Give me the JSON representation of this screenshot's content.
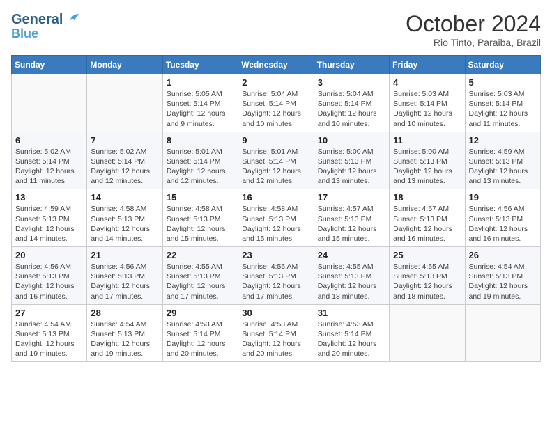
{
  "header": {
    "logo_line1": "General",
    "logo_line2": "Blue",
    "month": "October 2024",
    "location": "Rio Tinto, Paraiba, Brazil"
  },
  "weekdays": [
    "Sunday",
    "Monday",
    "Tuesday",
    "Wednesday",
    "Thursday",
    "Friday",
    "Saturday"
  ],
  "weeks": [
    [
      {
        "day": "",
        "info": ""
      },
      {
        "day": "",
        "info": ""
      },
      {
        "day": "1",
        "info": "Sunrise: 5:05 AM\nSunset: 5:14 PM\nDaylight: 12 hours and 9 minutes."
      },
      {
        "day": "2",
        "info": "Sunrise: 5:04 AM\nSunset: 5:14 PM\nDaylight: 12 hours and 10 minutes."
      },
      {
        "day": "3",
        "info": "Sunrise: 5:04 AM\nSunset: 5:14 PM\nDaylight: 12 hours and 10 minutes."
      },
      {
        "day": "4",
        "info": "Sunrise: 5:03 AM\nSunset: 5:14 PM\nDaylight: 12 hours and 10 minutes."
      },
      {
        "day": "5",
        "info": "Sunrise: 5:03 AM\nSunset: 5:14 PM\nDaylight: 12 hours and 11 minutes."
      }
    ],
    [
      {
        "day": "6",
        "info": "Sunrise: 5:02 AM\nSunset: 5:14 PM\nDaylight: 12 hours and 11 minutes."
      },
      {
        "day": "7",
        "info": "Sunrise: 5:02 AM\nSunset: 5:14 PM\nDaylight: 12 hours and 12 minutes."
      },
      {
        "day": "8",
        "info": "Sunrise: 5:01 AM\nSunset: 5:14 PM\nDaylight: 12 hours and 12 minutes."
      },
      {
        "day": "9",
        "info": "Sunrise: 5:01 AM\nSunset: 5:14 PM\nDaylight: 12 hours and 12 minutes."
      },
      {
        "day": "10",
        "info": "Sunrise: 5:00 AM\nSunset: 5:13 PM\nDaylight: 12 hours and 13 minutes."
      },
      {
        "day": "11",
        "info": "Sunrise: 5:00 AM\nSunset: 5:13 PM\nDaylight: 12 hours and 13 minutes."
      },
      {
        "day": "12",
        "info": "Sunrise: 4:59 AM\nSunset: 5:13 PM\nDaylight: 12 hours and 13 minutes."
      }
    ],
    [
      {
        "day": "13",
        "info": "Sunrise: 4:59 AM\nSunset: 5:13 PM\nDaylight: 12 hours and 14 minutes."
      },
      {
        "day": "14",
        "info": "Sunrise: 4:58 AM\nSunset: 5:13 PM\nDaylight: 12 hours and 14 minutes."
      },
      {
        "day": "15",
        "info": "Sunrise: 4:58 AM\nSunset: 5:13 PM\nDaylight: 12 hours and 15 minutes."
      },
      {
        "day": "16",
        "info": "Sunrise: 4:58 AM\nSunset: 5:13 PM\nDaylight: 12 hours and 15 minutes."
      },
      {
        "day": "17",
        "info": "Sunrise: 4:57 AM\nSunset: 5:13 PM\nDaylight: 12 hours and 15 minutes."
      },
      {
        "day": "18",
        "info": "Sunrise: 4:57 AM\nSunset: 5:13 PM\nDaylight: 12 hours and 16 minutes."
      },
      {
        "day": "19",
        "info": "Sunrise: 4:56 AM\nSunset: 5:13 PM\nDaylight: 12 hours and 16 minutes."
      }
    ],
    [
      {
        "day": "20",
        "info": "Sunrise: 4:56 AM\nSunset: 5:13 PM\nDaylight: 12 hours and 16 minutes."
      },
      {
        "day": "21",
        "info": "Sunrise: 4:56 AM\nSunset: 5:13 PM\nDaylight: 12 hours and 17 minutes."
      },
      {
        "day": "22",
        "info": "Sunrise: 4:55 AM\nSunset: 5:13 PM\nDaylight: 12 hours and 17 minutes."
      },
      {
        "day": "23",
        "info": "Sunrise: 4:55 AM\nSunset: 5:13 PM\nDaylight: 12 hours and 17 minutes."
      },
      {
        "day": "24",
        "info": "Sunrise: 4:55 AM\nSunset: 5:13 PM\nDaylight: 12 hours and 18 minutes."
      },
      {
        "day": "25",
        "info": "Sunrise: 4:55 AM\nSunset: 5:13 PM\nDaylight: 12 hours and 18 minutes."
      },
      {
        "day": "26",
        "info": "Sunrise: 4:54 AM\nSunset: 5:13 PM\nDaylight: 12 hours and 19 minutes."
      }
    ],
    [
      {
        "day": "27",
        "info": "Sunrise: 4:54 AM\nSunset: 5:13 PM\nDaylight: 12 hours and 19 minutes."
      },
      {
        "day": "28",
        "info": "Sunrise: 4:54 AM\nSunset: 5:13 PM\nDaylight: 12 hours and 19 minutes."
      },
      {
        "day": "29",
        "info": "Sunrise: 4:53 AM\nSunset: 5:14 PM\nDaylight: 12 hours and 20 minutes."
      },
      {
        "day": "30",
        "info": "Sunrise: 4:53 AM\nSunset: 5:14 PM\nDaylight: 12 hours and 20 minutes."
      },
      {
        "day": "31",
        "info": "Sunrise: 4:53 AM\nSunset: 5:14 PM\nDaylight: 12 hours and 20 minutes."
      },
      {
        "day": "",
        "info": ""
      },
      {
        "day": "",
        "info": ""
      }
    ]
  ]
}
